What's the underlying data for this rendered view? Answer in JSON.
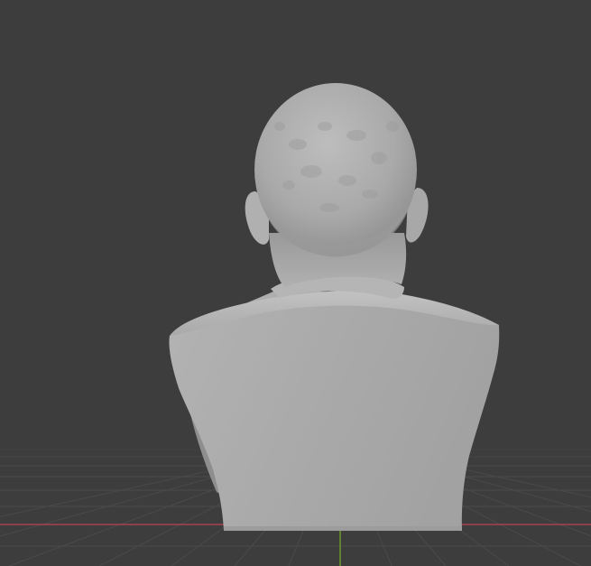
{
  "viewport": {
    "view": "back",
    "subject": "bust-sculpture",
    "background_color": "#3d3d3d",
    "grid_color": "#4a4a4a",
    "x_axis_color": "#a8424e",
    "y_axis_color": "#6c9a2c",
    "model_color": "#a5a5a5"
  }
}
